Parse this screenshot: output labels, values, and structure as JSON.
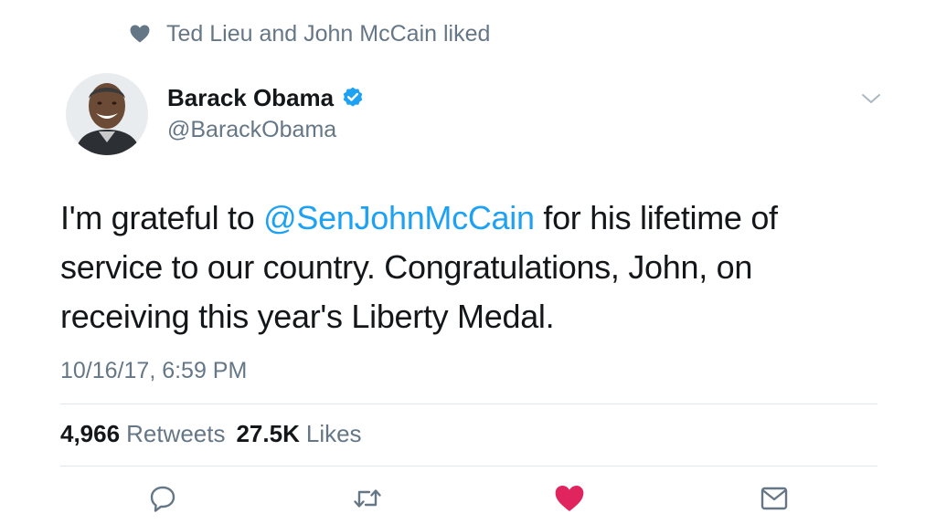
{
  "social_context": {
    "text": "Ted Lieu and John McCain liked",
    "icon": "heart-icon"
  },
  "author": {
    "name": "Barack Obama",
    "handle": "@BarackObama",
    "verified": true,
    "verified_icon": "verified-badge-icon"
  },
  "tweet": {
    "text_parts": [
      {
        "text": "I'm grateful to ",
        "type": "text"
      },
      {
        "text": "@SenJohnMcCain",
        "type": "mention"
      },
      {
        "text": " for his lifetime of service to our country. Congratulations, John, on receiving this year's Liberty Medal.",
        "type": "text"
      }
    ],
    "timestamp": "10/16/17, 6:59 PM"
  },
  "stats": {
    "retweets_count": "4,966",
    "retweets_label": "Retweets",
    "likes_count": "27.5K",
    "likes_label": "Likes"
  },
  "actions": [
    {
      "name": "reply",
      "icon": "reply-icon"
    },
    {
      "name": "retweet",
      "icon": "retweet-icon"
    },
    {
      "name": "like",
      "icon": "heart-icon",
      "active": true
    },
    {
      "name": "direct-message",
      "icon": "envelope-icon"
    }
  ],
  "colors": {
    "text_primary": "#14171a",
    "text_secondary": "#657786",
    "link": "#1da1f2",
    "like_active": "#e0245e",
    "divider": "#e1e8ed"
  }
}
